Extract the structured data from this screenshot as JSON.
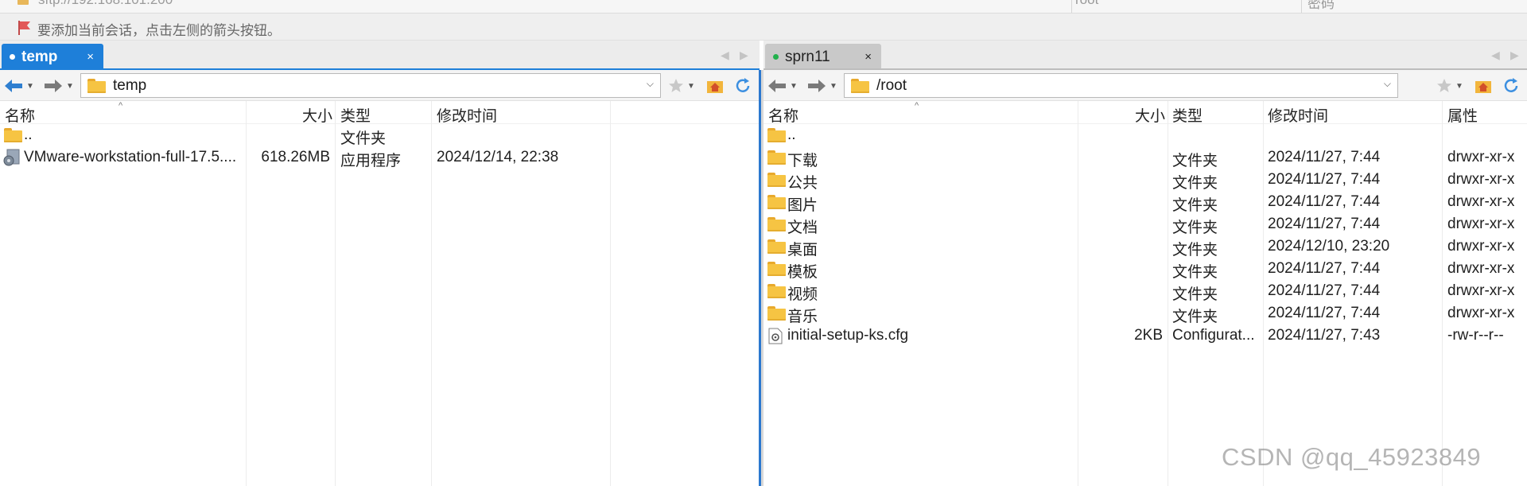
{
  "top_strip": {
    "cut_text_1": "sftp://192.168.101.200",
    "cut_text_2": "root",
    "cut_text_3": "密码"
  },
  "hint": {
    "text": "要添加当前会话，点击左侧的箭头按钮。"
  },
  "left_panel": {
    "tab": {
      "label": "temp",
      "close": "×",
      "active": true
    },
    "path": "temp",
    "columns": [
      "名称",
      "大小",
      "类型",
      "修改时间"
    ],
    "rows": [
      {
        "name": "..",
        "size": "",
        "type": "文件夹",
        "modified": "",
        "icon": "folder-icon"
      },
      {
        "name": "VMware-workstation-full-17.5....",
        "size": "618.26MB",
        "type": "应用程序",
        "modified": "2024/12/14, 22:38",
        "icon": "installer-icon"
      }
    ]
  },
  "right_panel": {
    "tab": {
      "label": "sprn11",
      "close": "×",
      "active": false
    },
    "path": "/root",
    "columns": [
      "名称",
      "大小",
      "类型",
      "修改时间",
      "属性"
    ],
    "rows": [
      {
        "name": "..",
        "size": "",
        "type": "",
        "modified": "",
        "attr": "",
        "icon": "folder-icon"
      },
      {
        "name": "下载",
        "size": "",
        "type": "文件夹",
        "modified": "2024/11/27, 7:44",
        "attr": "drwxr-xr-x",
        "icon": "folder-icon"
      },
      {
        "name": "公共",
        "size": "",
        "type": "文件夹",
        "modified": "2024/11/27, 7:44",
        "attr": "drwxr-xr-x",
        "icon": "folder-icon"
      },
      {
        "name": "图片",
        "size": "",
        "type": "文件夹",
        "modified": "2024/11/27, 7:44",
        "attr": "drwxr-xr-x",
        "icon": "folder-icon"
      },
      {
        "name": "文档",
        "size": "",
        "type": "文件夹",
        "modified": "2024/11/27, 7:44",
        "attr": "drwxr-xr-x",
        "icon": "folder-icon"
      },
      {
        "name": "桌面",
        "size": "",
        "type": "文件夹",
        "modified": "2024/12/10, 23:20",
        "attr": "drwxr-xr-x",
        "icon": "folder-icon"
      },
      {
        "name": "模板",
        "size": "",
        "type": "文件夹",
        "modified": "2024/11/27, 7:44",
        "attr": "drwxr-xr-x",
        "icon": "folder-icon"
      },
      {
        "name": "视频",
        "size": "",
        "type": "文件夹",
        "modified": "2024/11/27, 7:44",
        "attr": "drwxr-xr-x",
        "icon": "folder-icon"
      },
      {
        "name": "音乐",
        "size": "",
        "type": "文件夹",
        "modified": "2024/11/27, 7:44",
        "attr": "drwxr-xr-x",
        "icon": "folder-icon"
      },
      {
        "name": "initial-setup-ks.cfg",
        "size": "2KB",
        "type": "Configurat...",
        "modified": "2024/11/27, 7:43",
        "attr": "-rw-r--r--",
        "icon": "config-file-icon"
      }
    ]
  },
  "watermark": "CSDN @qq_45923849",
  "colors": {
    "accent_blue": "#1e7fd9",
    "connected_green": "#22b14c",
    "folder_yellow": "#f6c443"
  }
}
